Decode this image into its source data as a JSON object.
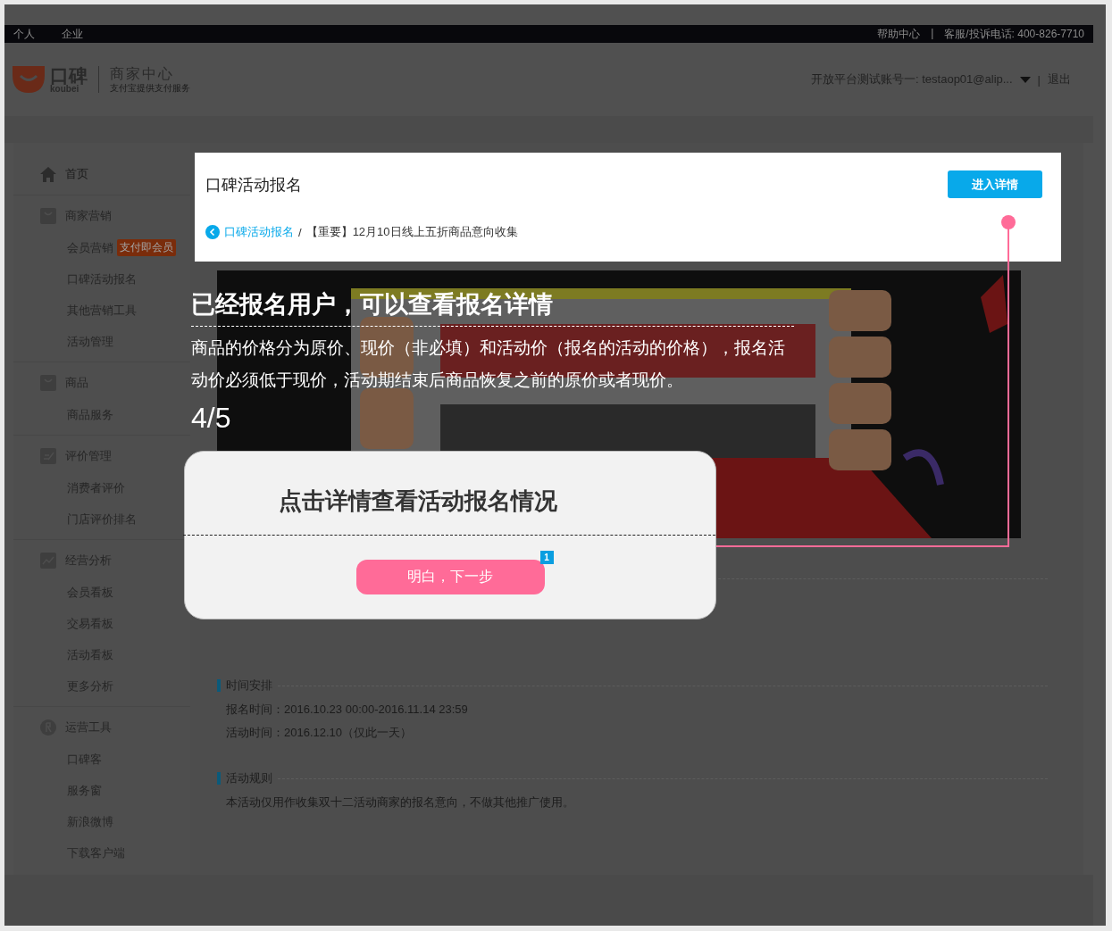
{
  "top_bar": {
    "links": [
      "个人",
      "企业"
    ],
    "help": "帮助中心",
    "separator": "|",
    "hotline": "客服/投诉电话: 400-826-7710"
  },
  "header": {
    "logo": {
      "name": "口碑",
      "pinyin": "koubei",
      "title": "商家中心",
      "subtitle": "支付宝提供支付服务"
    },
    "account": "开放平台测试账号一: testaop01@alip...",
    "separator": "|",
    "logout": "退出"
  },
  "sidebar": [
    {
      "kind": "home",
      "label": "首页"
    },
    {
      "kind": "bag",
      "label": "商家营销",
      "items": [
        {
          "label": "会员营销",
          "badge": "支付即会员"
        },
        {
          "label": "口碑活动报名"
        },
        {
          "label": "其他营销工具"
        },
        {
          "label": "活动管理"
        }
      ]
    },
    {
      "kind": "bag",
      "label": "商品",
      "items": [
        {
          "label": "商品服务"
        }
      ]
    },
    {
      "kind": "edit",
      "label": "评价管理",
      "items": [
        {
          "label": "消费者评价"
        },
        {
          "label": "门店评价排名"
        }
      ]
    },
    {
      "kind": "chart",
      "label": "经营分析",
      "items": [
        {
          "label": "会员看板"
        },
        {
          "label": "交易看板"
        },
        {
          "label": "活动看板"
        },
        {
          "label": "更多分析"
        }
      ]
    },
    {
      "kind": "tool",
      "label": "运营工具",
      "items": [
        {
          "label": "口碑客"
        },
        {
          "label": "服务窗"
        },
        {
          "label": "新浪微博"
        },
        {
          "label": "下载客户端"
        }
      ]
    }
  ],
  "card": {
    "title": "口碑活动报名",
    "button": "进入详情",
    "breadcrumb": {
      "link": "口碑活动报名",
      "separator": "/",
      "current": "【重要】12月10日线上五折商品意向收集"
    }
  },
  "sections": [
    {
      "heading": "时间安排",
      "lines": [
        "报名时间：2016.10.23 00:00-2016.11.14 23:59",
        "活动时间：2016.12.10（仅此一天）"
      ]
    },
    {
      "heading": "活动规则",
      "lines": [
        "本活动仅用作收集双十二活动商家的报名意向，不做其他推广使用。"
      ]
    }
  ],
  "guide": {
    "title": "已经报名用户，可以查看报名详情",
    "text": "商品的价格分为原价、现价（非必填）和活动价（报名的活动的价格），报名活动价必须低于现价，活动期结束后商品恢复之前的原价或者现价。",
    "step": "4/5",
    "dialog": {
      "title": "点击详情查看活动报名情况",
      "button": "明白，下一步",
      "badge": "1"
    }
  }
}
